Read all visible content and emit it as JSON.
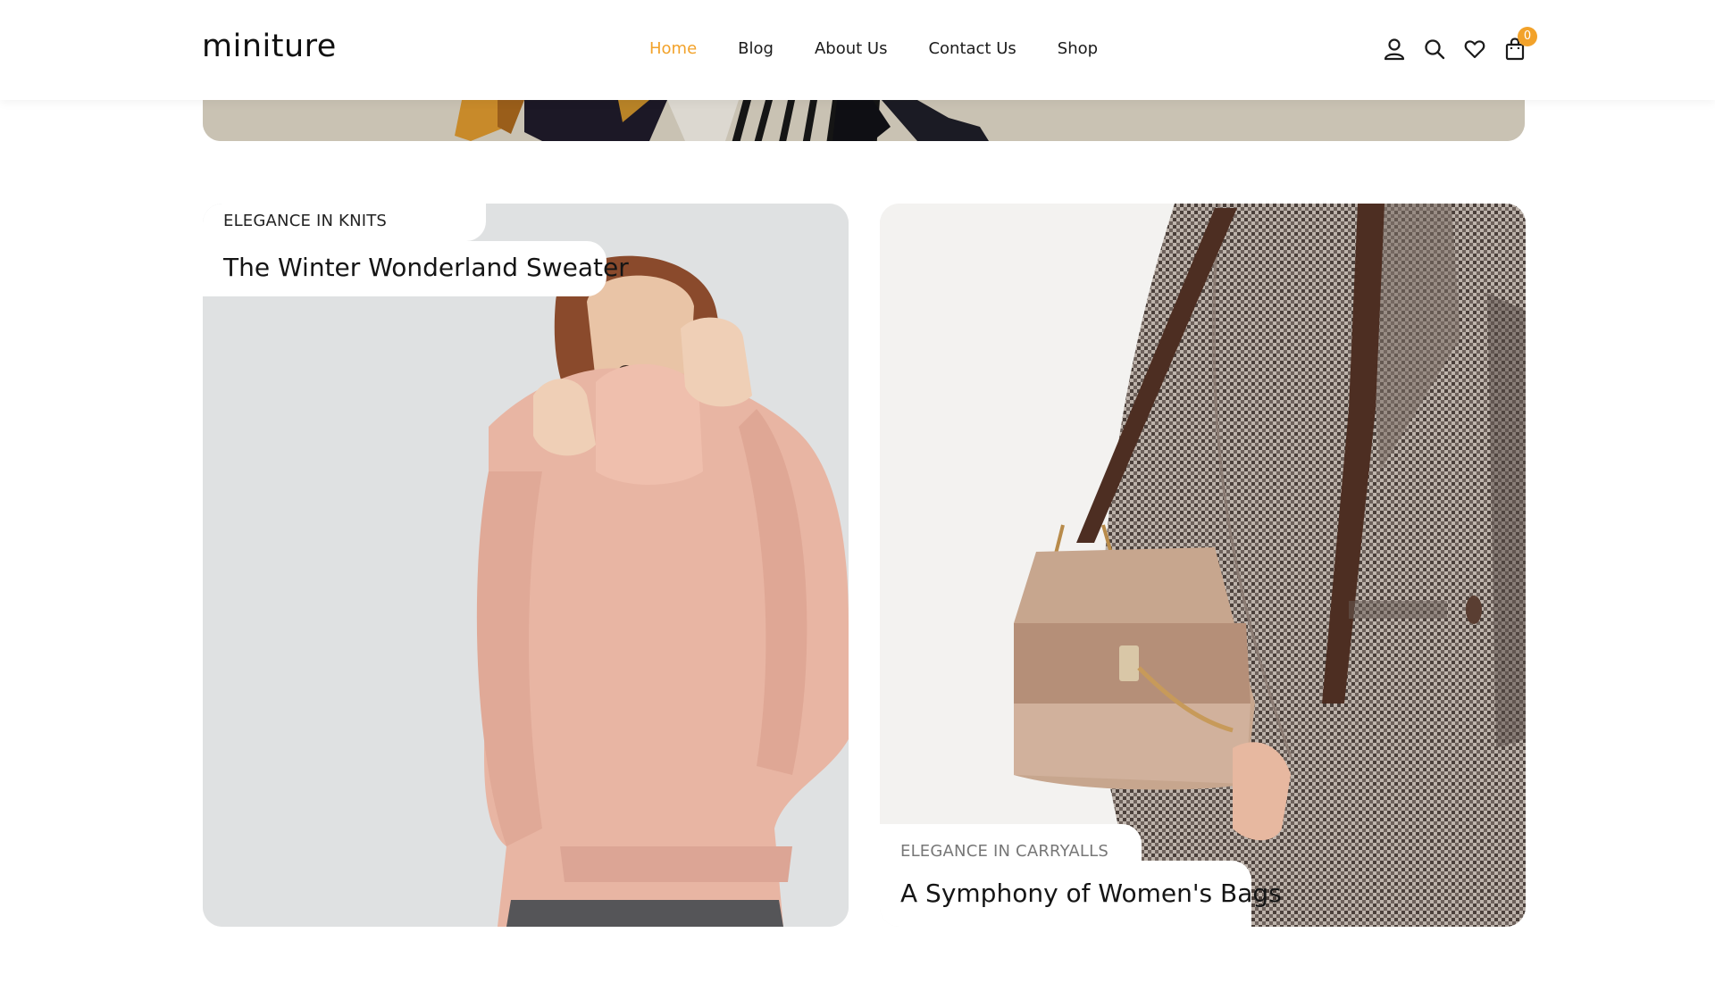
{
  "header": {
    "logo": "miniture",
    "nav": [
      {
        "label": "Home",
        "active": true
      },
      {
        "label": "Blog",
        "active": false
      },
      {
        "label": "About Us",
        "active": false
      },
      {
        "label": "Contact Us",
        "active": false
      },
      {
        "label": "Shop",
        "active": false
      }
    ],
    "icons": [
      "account-icon",
      "search-icon",
      "heart-icon",
      "bag-icon"
    ],
    "cart_count": "0"
  },
  "cards": [
    {
      "kicker": "ELEGANCE IN KNITS",
      "title": "The Winter Wonderland Sweater"
    },
    {
      "kicker": "ELEGANCE IN CARRYALLS",
      "title": "A Symphony of Women's Bags"
    }
  ],
  "colors": {
    "accent": "#f2a22a",
    "text": "#1b1b1b"
  }
}
